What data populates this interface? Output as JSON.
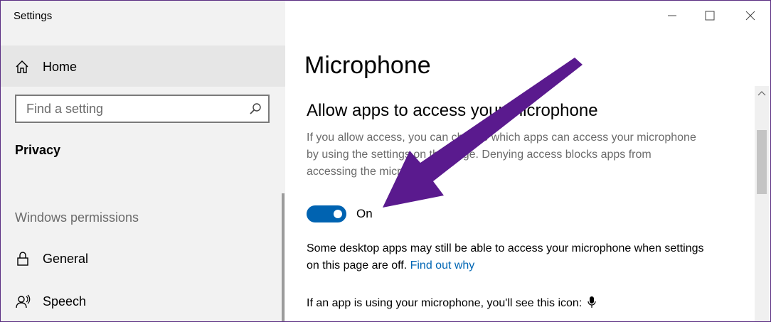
{
  "window": {
    "title": "Settings"
  },
  "sidebar": {
    "home_label": "Home",
    "search_placeholder": "Find a setting",
    "category": "Privacy",
    "section_label": "Windows permissions",
    "items": [
      {
        "label": "General",
        "icon": "lock-icon"
      },
      {
        "label": "Speech",
        "icon": "speech-icon"
      }
    ]
  },
  "content": {
    "title": "Microphone",
    "subtitle": "Allow apps to access your microphone",
    "description": "If you allow access, you can choose which apps can access your microphone by using the settings on this page. Denying access blocks apps from accessing the microphone.",
    "toggle": {
      "state_label": "On",
      "checked": true,
      "accent": "#0063b1"
    },
    "note_text": "Some desktop apps may still be able to access your microphone when settings on this page are off.",
    "note_link": "Find out why",
    "icon_note": "If an app is using your microphone, you'll see this icon:"
  },
  "annotation": {
    "arrow_color": "#5a1a8e"
  }
}
